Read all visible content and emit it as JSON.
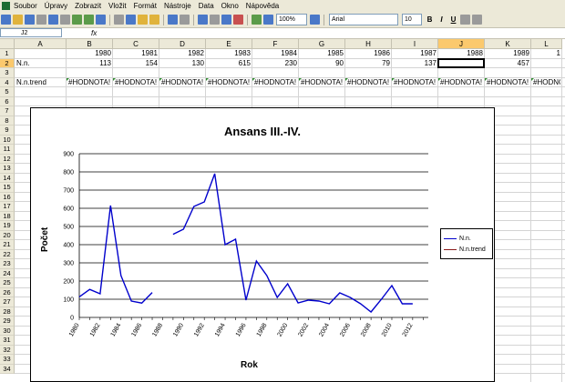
{
  "menubar": {
    "items": [
      "Soubor",
      "Úpravy",
      "Zobrazit",
      "Vložit",
      "Formát",
      "Nástroje",
      "Data",
      "Okno",
      "Nápověda"
    ]
  },
  "toolbar": {
    "zoom": "100%",
    "font_name": "Arial",
    "font_size": "10",
    "bold": "B",
    "italic": "I",
    "underline": "U"
  },
  "formula_bar": {
    "name_box": "J2",
    "fx": "fx",
    "content": ""
  },
  "sheet": {
    "columns": [
      "A",
      "B",
      "C",
      "D",
      "E",
      "F",
      "G",
      "H",
      "I",
      "J",
      "K",
      "L"
    ],
    "selected_column": "J",
    "selected_row": "2",
    "rows": [
      "1",
      "2",
      "3",
      "4",
      "5",
      "6",
      "7",
      "8",
      "9",
      "10",
      "11",
      "12",
      "13",
      "14",
      "15",
      "16",
      "17",
      "18",
      "19",
      "20",
      "21",
      "22",
      "23",
      "24",
      "25",
      "26",
      "27",
      "28",
      "29",
      "30",
      "31",
      "32",
      "33",
      "34"
    ],
    "row1_years": [
      "1980",
      "1981",
      "1982",
      "1983",
      "1984",
      "1985",
      "1986",
      "1987",
      "1988",
      "1989",
      "1"
    ],
    "row2_label": "N.n.",
    "row2_values": [
      "113",
      "154",
      "130",
      "615",
      "230",
      "90",
      "79",
      "137",
      "",
      "457",
      ""
    ],
    "row4_label": "N.n.trend",
    "row4_error": "#HODNOTA!"
  },
  "chart_data": {
    "type": "line",
    "title": "Ansans III.-IV.",
    "xlabel": "Rok",
    "ylabel": "Počet",
    "ylim": [
      0,
      900
    ],
    "yticks": [
      0,
      100,
      200,
      300,
      400,
      500,
      600,
      700,
      800,
      900
    ],
    "xticks": [
      "1980",
      "1982",
      "1984",
      "1986",
      "1988",
      "1990",
      "1992",
      "1994",
      "1996",
      "1998",
      "2000",
      "2002",
      "2004",
      "2006",
      "2008",
      "2010",
      "2012"
    ],
    "grid": true,
    "legend_position": "right",
    "x": [
      1980,
      1981,
      1982,
      1983,
      1984,
      1985,
      1986,
      1987,
      1988,
      1989,
      1990,
      1991,
      1992,
      1993,
      1994,
      1995,
      1996,
      1997,
      1998,
      1999,
      2000,
      2001,
      2002,
      2003,
      2004,
      2005,
      2006,
      2007,
      2008,
      2009,
      2010,
      2011,
      2012,
      2013
    ],
    "series": [
      {
        "name": "N.n.",
        "color": "#0000cc",
        "values": [
          113,
          154,
          130,
          615,
          230,
          90,
          79,
          137,
          null,
          457,
          485,
          610,
          635,
          790,
          400,
          430,
          95,
          310,
          230,
          110,
          185,
          80,
          95,
          90,
          75,
          135,
          110,
          75,
          30,
          100,
          175,
          75,
          75,
          null
        ]
      },
      {
        "name": "N.n.trend",
        "color": "#8b1a1a",
        "values": []
      }
    ]
  }
}
